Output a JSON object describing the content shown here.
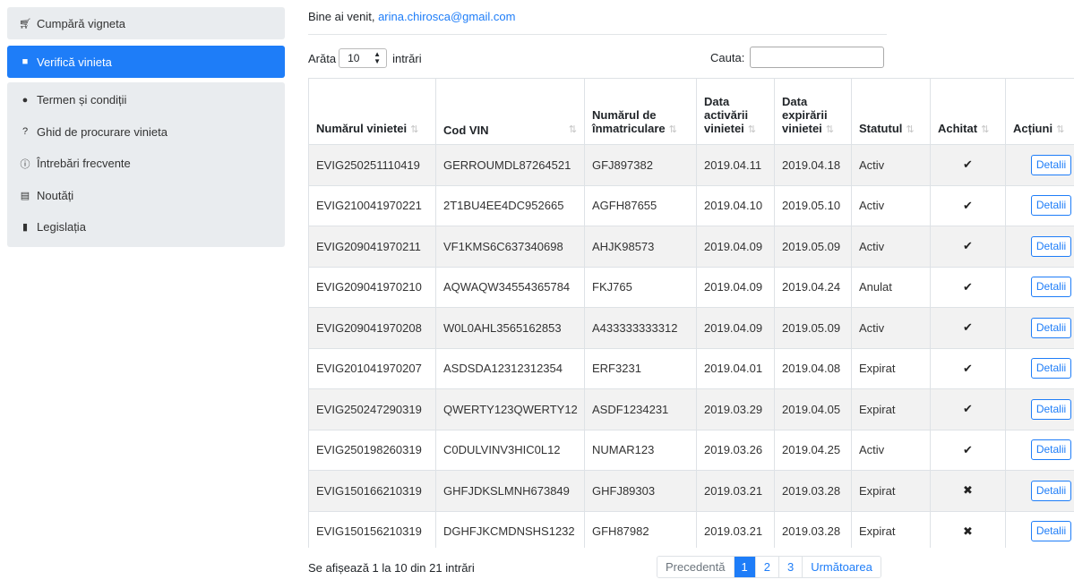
{
  "sidebar": {
    "items": [
      {
        "label": "Cumpără vigneta",
        "icon": "cart-icon"
      },
      {
        "label": "Verifică vinieta",
        "icon": "briefcase-icon"
      },
      {
        "label": "Termen și condiții",
        "icon": "comments-icon"
      },
      {
        "label": "Ghid de procurare vinieta",
        "icon": "question-circle-icon"
      },
      {
        "label": "Întrebări frecvente",
        "icon": "info-circle-icon"
      },
      {
        "label": "Noutăți",
        "icon": "newspaper-icon"
      },
      {
        "label": "Legislația",
        "icon": "file-icon"
      }
    ]
  },
  "header": {
    "welcome": "Bine ai venit,",
    "email": "arina.chirosca@gmail.com"
  },
  "controls": {
    "show_prefix": "Arăta",
    "show_value": "10",
    "show_suffix": "intrări",
    "search_label": "Cauta:",
    "search_value": ""
  },
  "table": {
    "columns": [
      "Numărul vinietei",
      "Cod VIN",
      "Numărul de înmatriculare",
      "Data activării vinietei",
      "Data expirării vinietei",
      "Statutul",
      "Achitat",
      "Acțiuni"
    ],
    "rows": [
      {
        "nr": "EVIG250251110419",
        "vin": "GERROUMDL87264521",
        "plate": "GFJ897382",
        "act": "2019.04.11",
        "exp": "2019.04.18",
        "status": "Activ",
        "paid": "✔",
        "action": "Detalii"
      },
      {
        "nr": "EVIG210041970221",
        "vin": "2T1BU4EE4DC952665",
        "plate": "AGFH87655",
        "act": "2019.04.10",
        "exp": "2019.05.10",
        "status": "Activ",
        "paid": "✔",
        "action": "Detalii"
      },
      {
        "nr": "EVIG209041970211",
        "vin": "VF1KMS6C637340698",
        "plate": "AHJK98573",
        "act": "2019.04.09",
        "exp": "2019.05.09",
        "status": "Activ",
        "paid": "✔",
        "action": "Detalii"
      },
      {
        "nr": "EVIG209041970210",
        "vin": "AQWAQW34554365784",
        "plate": "FKJ765",
        "act": "2019.04.09",
        "exp": "2019.04.24",
        "status": "Anulat",
        "paid": "✔",
        "action": "Detalii"
      },
      {
        "nr": "EVIG209041970208",
        "vin": "W0L0AHL3565162853",
        "plate": "A433333333312",
        "act": "2019.04.09",
        "exp": "2019.05.09",
        "status": "Activ",
        "paid": "✔",
        "action": "Detalii"
      },
      {
        "nr": "EVIG201041970207",
        "vin": "ASDSDA12312312354",
        "plate": "ERF3231",
        "act": "2019.04.01",
        "exp": "2019.04.08",
        "status": "Expirat",
        "paid": "✔",
        "action": "Detalii"
      },
      {
        "nr": "EVIG250247290319",
        "vin": "QWERTY123QWERTY12",
        "plate": "ASDF1234231",
        "act": "2019.03.29",
        "exp": "2019.04.05",
        "status": "Expirat",
        "paid": "✔",
        "action": "Detalii"
      },
      {
        "nr": "EVIG250198260319",
        "vin": "C0DULVINV3HIC0L12",
        "plate": "NUMAR123",
        "act": "2019.03.26",
        "exp": "2019.04.25",
        "status": "Activ",
        "paid": "✔",
        "action": "Detalii"
      },
      {
        "nr": "EVIG150166210319",
        "vin": "GHFJDKSLMNH673849",
        "plate": "GHFJ89303",
        "act": "2019.03.21",
        "exp": "2019.03.28",
        "status": "Expirat",
        "paid": "✖",
        "action": "Detalii"
      },
      {
        "nr": "EVIG150156210319",
        "vin": "DGHFJKCMDNSHS1232",
        "plate": "GFH87982",
        "act": "2019.03.21",
        "exp": "2019.03.28",
        "status": "Expirat",
        "paid": "✖",
        "action": "Detalii"
      }
    ]
  },
  "footer": {
    "info": "Se afișează 1 la 10 din 21 intrări",
    "prev": "Precedentă",
    "pages": [
      "1",
      "2",
      "3"
    ],
    "current_page": "1",
    "next": "Următoarea"
  },
  "colors": {
    "accent": "#1e7df8",
    "sidebar_bg": "#e9ecef",
    "row_stripe": "#f2f2f2"
  }
}
